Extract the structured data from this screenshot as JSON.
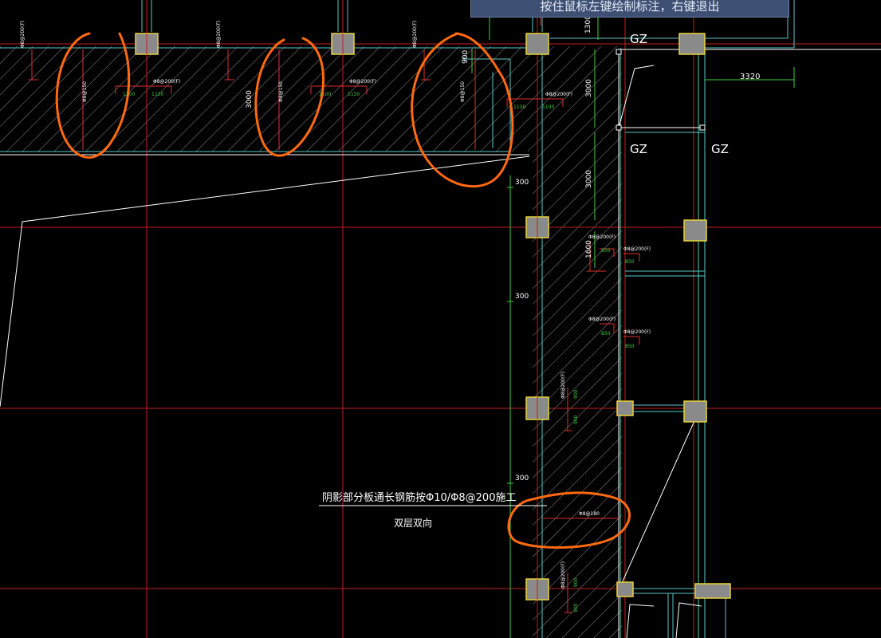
{
  "status_prompt": "按住鼠标左键绘制标注，右键退出",
  "colors": {
    "background": "#000000",
    "axis": "#c81e1e",
    "hatch": "#9a9a9a",
    "beam": "#6ad0d0",
    "rebar": "#e03030",
    "dimension": "#3ed13e",
    "column_fill": "#8a8a8a",
    "column_border": "#e8d23a",
    "annotation_mark": "#ff6a10",
    "text": "#ffffff"
  },
  "labels": {
    "gz": "GZ",
    "dim_1300": "1300",
    "dim_3320": "3320",
    "dim_3000": "3000",
    "dim_3000b": "3000",
    "dim_1600": "1600",
    "dim_300_a": "300",
    "dim_300_b": "300",
    "dim_300_c": "300",
    "dim_900": "900",
    "note_line1": "阴影部分板通长钢筋按Φ10/Φ8@200施工",
    "note_line2": "双层双向"
  },
  "rebar_labels": {
    "top_spec": "Φ8@200(F)",
    "top_len": "1100",
    "top_len_b": "1130",
    "slab_spec": "Φ8@150",
    "right_spec": "Φ8@200(F)",
    "right_len": "850",
    "vert_len": "900",
    "bottom_spec": "Φ8@180"
  }
}
